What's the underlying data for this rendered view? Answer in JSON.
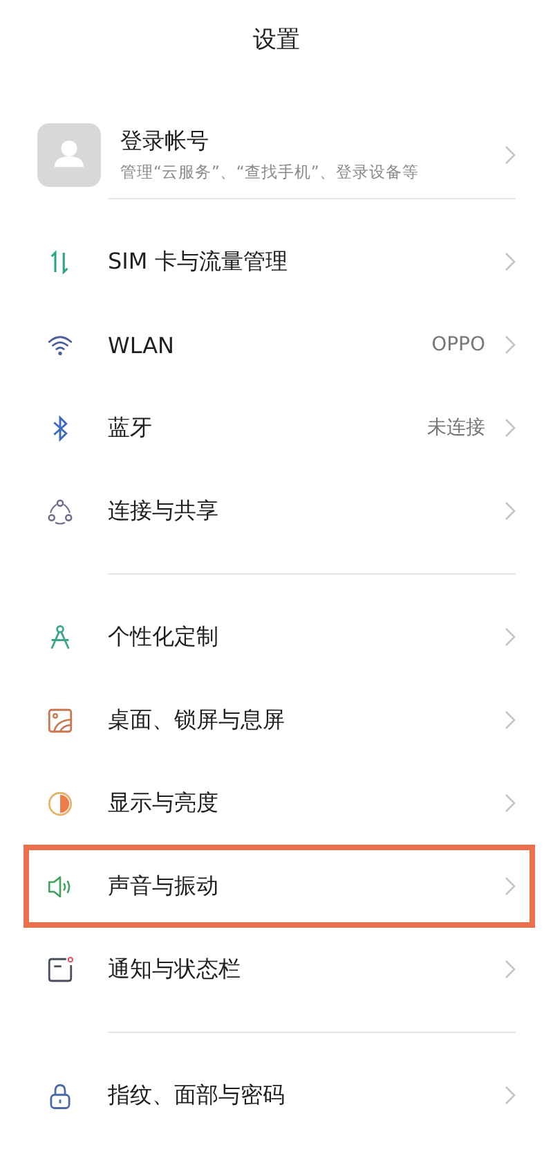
{
  "title": "设置",
  "account": {
    "name": "登录帐号",
    "subtitle": "管理“云服务”、“查找手机”、登录设备等"
  },
  "sections": [
    {
      "items": [
        {
          "label": "SIM 卡与流量管理",
          "highlighted": false
        },
        {
          "label": "WLAN",
          "value": "OPPO",
          "highlighted": false
        },
        {
          "label": "蓝牙",
          "value": "未连接",
          "highlighted": false
        },
        {
          "label": "连接与共享",
          "highlighted": false
        }
      ]
    },
    {
      "items": [
        {
          "label": "个性化定制",
          "highlighted": false
        },
        {
          "label": "桌面、锁屏与息屏",
          "highlighted": false
        },
        {
          "label": "显示与亮度",
          "highlighted": false
        },
        {
          "label": "声音与振动",
          "highlighted": true
        },
        {
          "label": "通知与状态栏",
          "highlighted": false
        }
      ]
    },
    {
      "items": [
        {
          "label": "指纹、面部与密码",
          "highlighted": false
        }
      ]
    }
  ]
}
